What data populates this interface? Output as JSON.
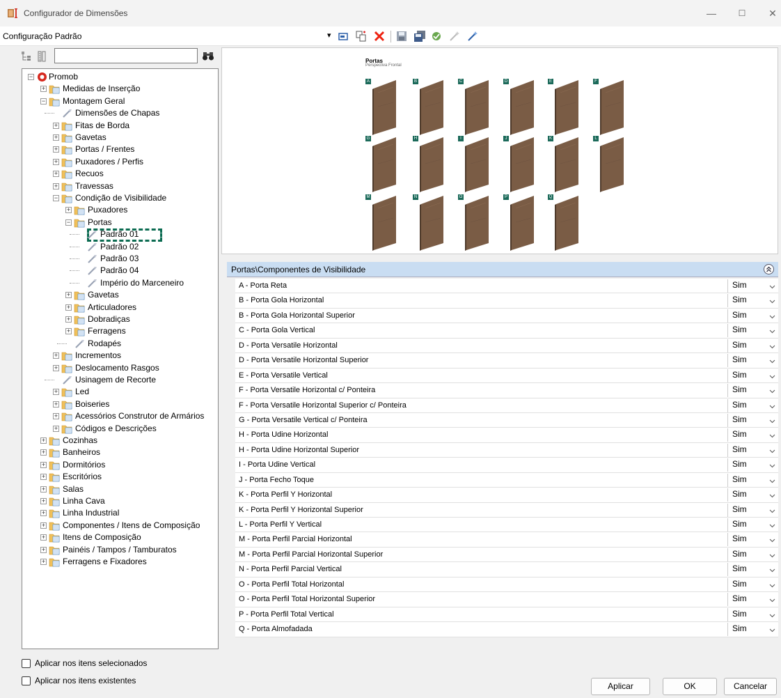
{
  "window": {
    "title": "Configurador de Dimensões",
    "minimize": "—",
    "maximize": "☐",
    "close": "✕"
  },
  "toolbar": {
    "config_label": "Configuração Padrão",
    "dropdown_arrow": "▾"
  },
  "search": {
    "value": "",
    "placeholder": ""
  },
  "tree": {
    "root": "Promob",
    "items": [
      {
        "label": "Medidas de Inserção"
      },
      {
        "label": "Montagem Geral"
      },
      {
        "label": "Dimensões de Chapas"
      },
      {
        "label": "Fitas de Borda"
      },
      {
        "label": "Gavetas"
      },
      {
        "label": "Portas / Frentes"
      },
      {
        "label": "Puxadores / Perfis"
      },
      {
        "label": "Recuos"
      },
      {
        "label": "Travessas"
      },
      {
        "label": "Condição de Visibilidade"
      },
      {
        "label": "Puxadores"
      },
      {
        "label": "Portas"
      },
      {
        "label": "Padrão 01"
      },
      {
        "label": "Padrão 02"
      },
      {
        "label": "Padrão 03"
      },
      {
        "label": "Padrão 04"
      },
      {
        "label": "Império do Marceneiro"
      },
      {
        "label": "Gavetas"
      },
      {
        "label": "Articuladores"
      },
      {
        "label": "Dobradiças"
      },
      {
        "label": "Ferragens"
      },
      {
        "label": "Rodapés"
      },
      {
        "label": "Incrementos"
      },
      {
        "label": "Deslocamento Rasgos"
      },
      {
        "label": "Usinagem de Recorte"
      },
      {
        "label": "Led"
      },
      {
        "label": "Boiseries"
      },
      {
        "label": "Acessórios Construtor de Armários"
      },
      {
        "label": "Códigos e Descrições"
      },
      {
        "label": "Cozinhas"
      },
      {
        "label": "Banheiros"
      },
      {
        "label": "Dormitórios"
      },
      {
        "label": "Escritórios"
      },
      {
        "label": "Salas"
      },
      {
        "label": "Linha Cava"
      },
      {
        "label": "Linha Industrial"
      },
      {
        "label": "Componentes / Itens de Composição"
      },
      {
        "label": "Itens de Composição"
      },
      {
        "label": "Painéis / Tampos / Tamburatos"
      },
      {
        "label": "Ferragens e Fixadores"
      }
    ]
  },
  "options": {
    "apply_selected": "Aplicar nos itens selecionados",
    "apply_existing": "Aplicar nos itens existentes"
  },
  "preview": {
    "title": "Portas",
    "subtitle": "Perspectiva Frontal",
    "door_tags": [
      "A",
      "B",
      "C",
      "D",
      "E",
      "F",
      "G",
      "H",
      "I",
      "J",
      "K",
      "L",
      "M",
      "N",
      "O",
      "P",
      "Q"
    ],
    "door_color": "#7a5c45"
  },
  "grid": {
    "header": "Portas\\Componentes de Visibilidade",
    "collapse": "«",
    "rows": [
      {
        "name": "A - Porta Reta",
        "value": "Sim"
      },
      {
        "name": "B - Porta Gola Horizontal",
        "value": "Sim"
      },
      {
        "name": "B - Porta Gola Horizontal Superior",
        "value": "Sim"
      },
      {
        "name": "C - Porta Gola Vertical",
        "value": "Sim"
      },
      {
        "name": "D - Porta Versatile Horizontal",
        "value": "Sim"
      },
      {
        "name": "D - Porta Versatile Horizontal Superior",
        "value": "Sim"
      },
      {
        "name": "E - Porta Versatile Vertical",
        "value": "Sim"
      },
      {
        "name": "F - Porta Versatile Horizontal c/ Ponteira",
        "value": "Sim"
      },
      {
        "name": "F - Porta Versatile Horizontal Superior c/ Ponteira",
        "value": "Sim"
      },
      {
        "name": "G - Porta Versatile Vertical c/ Ponteira",
        "value": "Sim"
      },
      {
        "name": "H - Porta Udine Horizontal",
        "value": "Sim"
      },
      {
        "name": "H - Porta Udine Horizontal Superior",
        "value": "Sim"
      },
      {
        "name": "I - Porta Udine Vertical",
        "value": "Sim"
      },
      {
        "name": "J - Porta Fecho Toque",
        "value": "Sim"
      },
      {
        "name": "K - Porta Perfil Y Horizontal",
        "value": "Sim"
      },
      {
        "name": "K - Porta Perfil Y Horizontal Superior",
        "value": "Sim"
      },
      {
        "name": "L - Porta Perfil Y Vertical",
        "value": "Sim"
      },
      {
        "name": "M - Porta Perfil Parcial Horizontal",
        "value": "Sim"
      },
      {
        "name": "M - Porta Perfil Parcial Horizontal Superior",
        "value": "Sim"
      },
      {
        "name": "N - Porta Perfil Parcial Vertical",
        "value": "Sim"
      },
      {
        "name": "O - Porta Perfil Total Horizontal",
        "value": "Sim"
      },
      {
        "name": "O - Porta Perfil Total Horizontal Superior",
        "value": "Sim"
      },
      {
        "name": "P - Porta Perfil Total Vertical",
        "value": "Sim"
      },
      {
        "name": "Q - Porta Almofadada",
        "value": "Sim"
      }
    ]
  },
  "buttons": {
    "apply": "Aplicar",
    "ok": "OK",
    "cancel": "Cancelar"
  }
}
